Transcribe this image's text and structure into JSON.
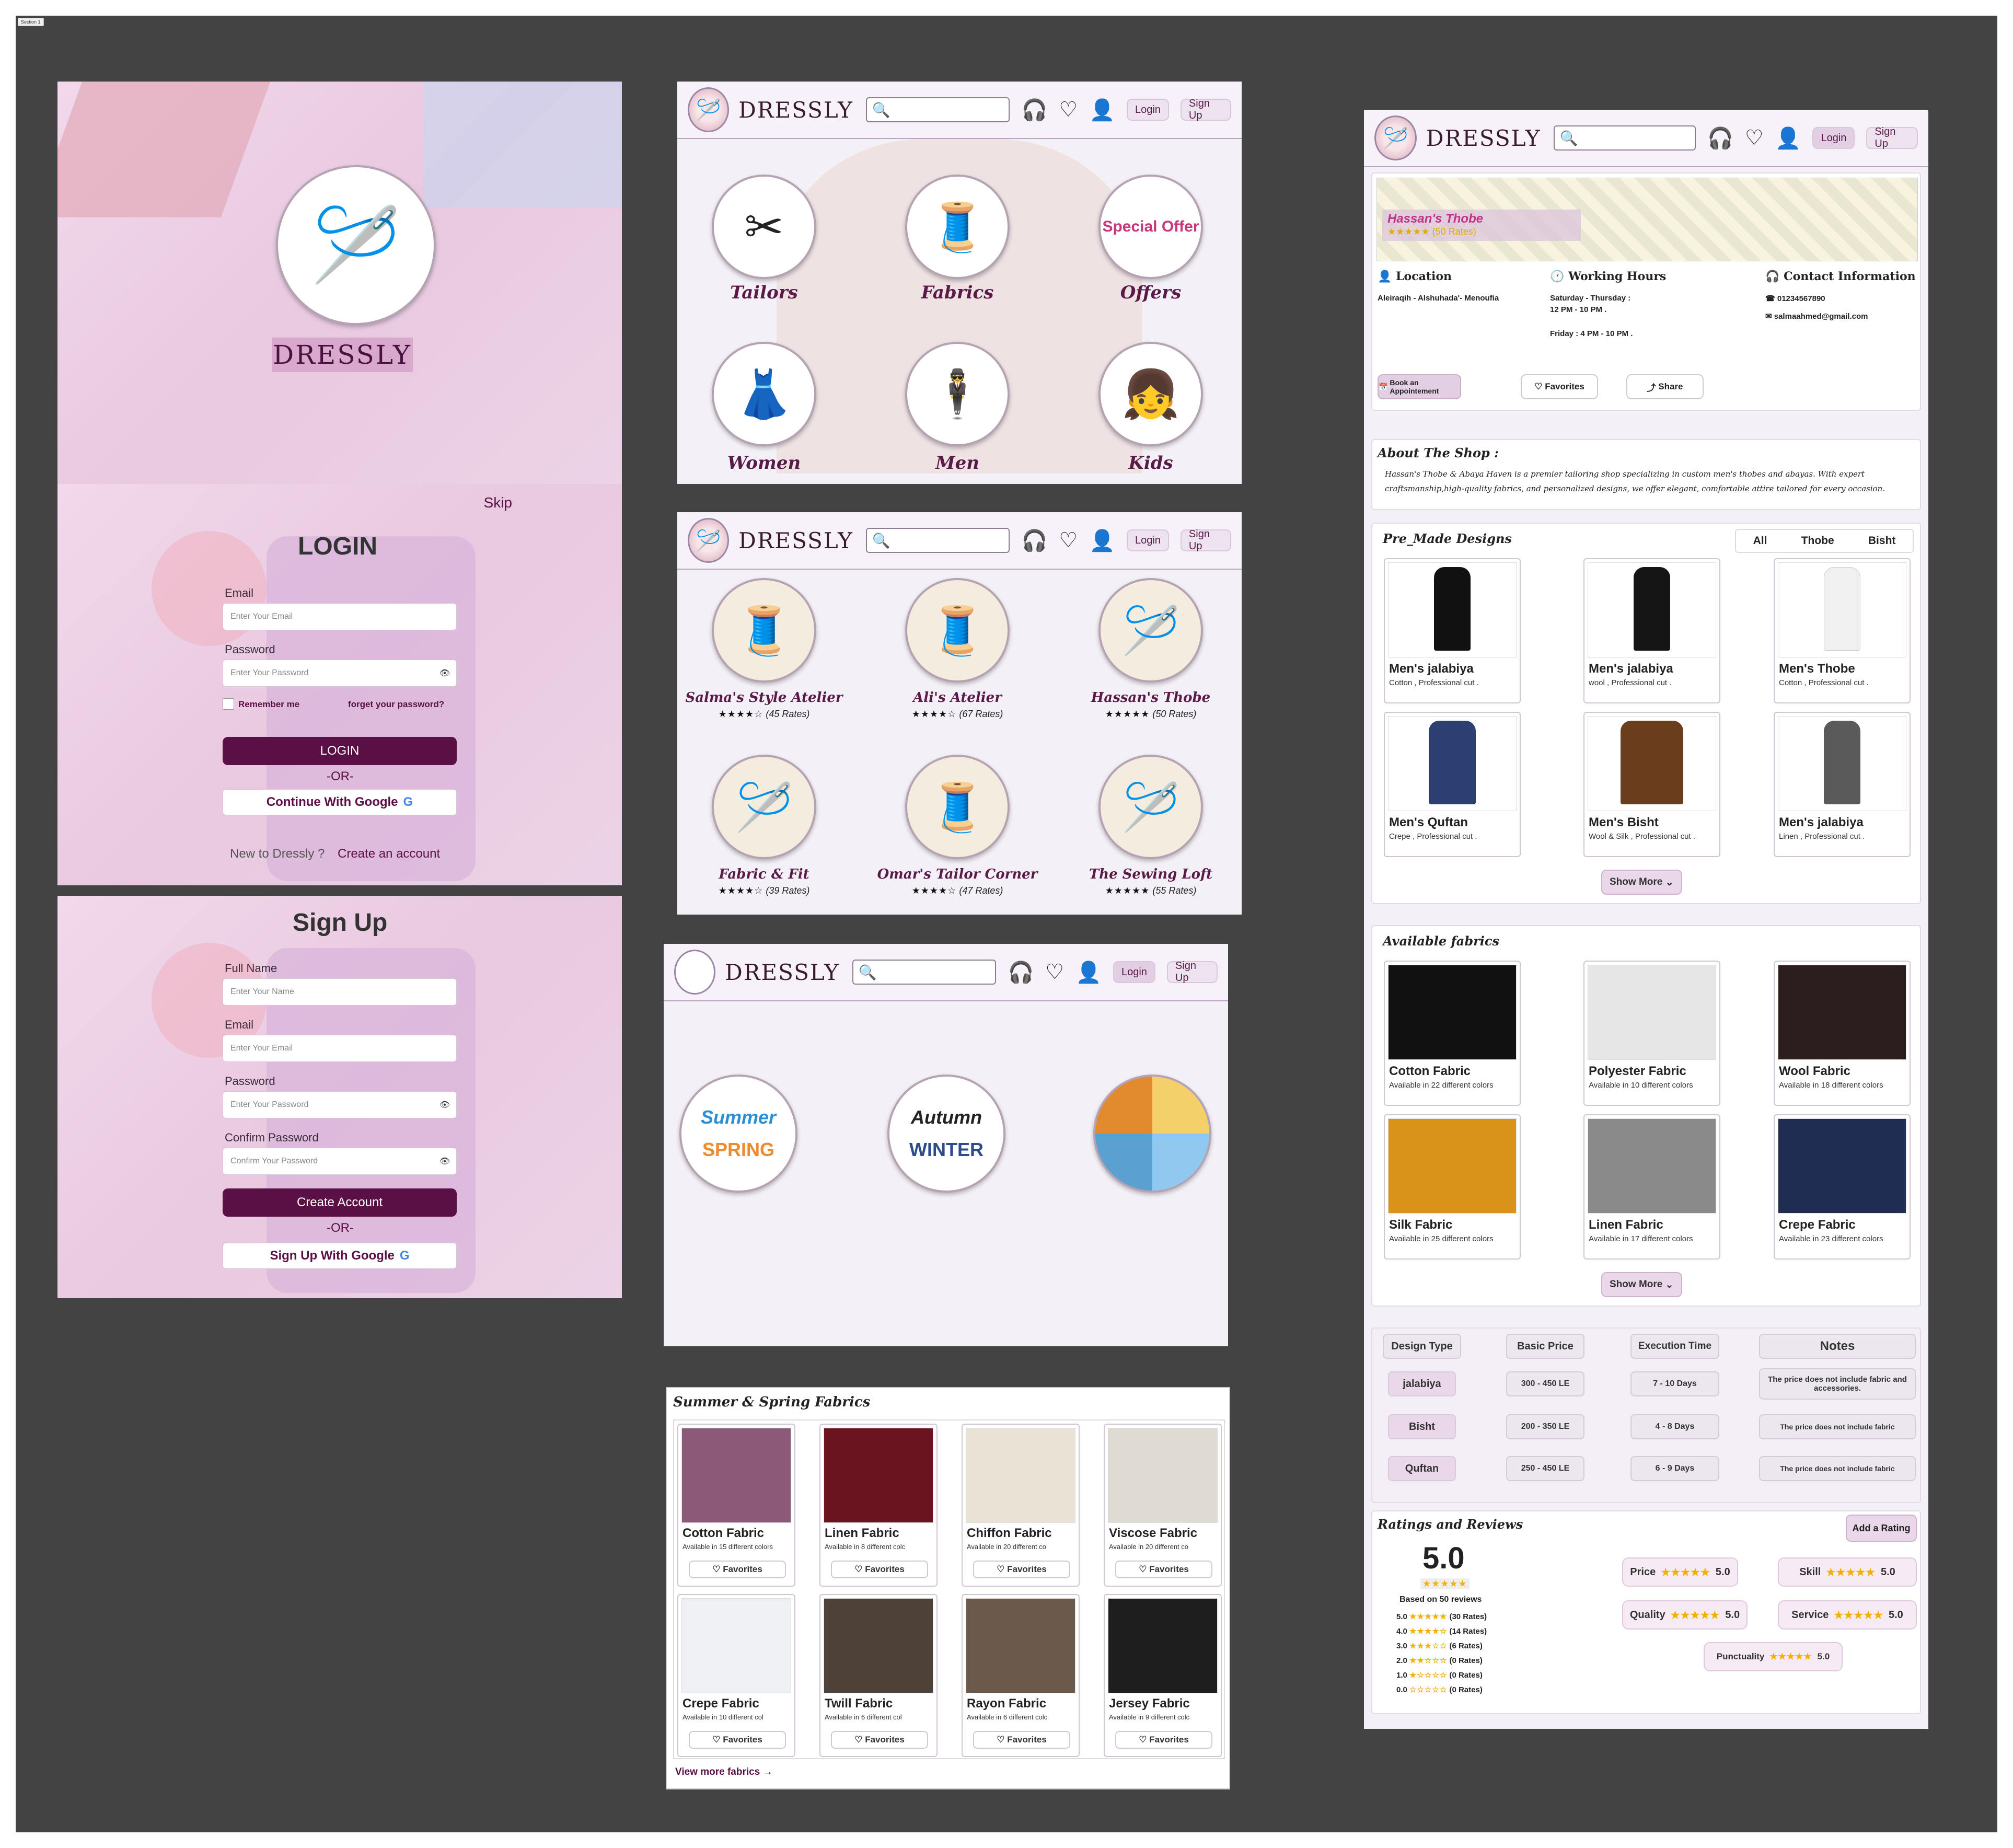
{
  "section_tag": "Section 1",
  "brand": "DRESSLY",
  "nav": {
    "login": "Login",
    "signup": "Sign Up"
  },
  "icons": {
    "search": "🔍",
    "support": "🎧",
    "heart": "♡",
    "user": "👤",
    "logo": "🪡"
  },
  "colors": {
    "primary": "#5a0f45",
    "accent": "#e3cfe3",
    "bg_dark": "#434343"
  },
  "splash": {
    "brand": "DRESSLY"
  },
  "login": {
    "skip": "Skip",
    "title": "LOGIN",
    "email_label": "Email",
    "email_ph": "Enter Your Email",
    "password_label": "Password",
    "password_ph": "Enter Your Password",
    "remember": "Remember me",
    "forgot": "forget your password?",
    "button": "LOGIN",
    "or": "-OR-",
    "google": "Continue With Google",
    "new_text": "New to Dressly ?",
    "create": "Create an account"
  },
  "signup": {
    "title": "Sign Up",
    "name_label": "Full Name",
    "name_ph": "Enter Your Name",
    "email_label": "Email",
    "email_ph": "Enter Your Email",
    "password_label": "Password",
    "password_ph": "Enter Your Password",
    "confirm_label": "Confirm Password",
    "confirm_ph": "Confirm Your Password",
    "button": "Create Account",
    "or": "-OR-",
    "google": "Sign Up With Google"
  },
  "home": {
    "categories": [
      {
        "label": "Tailors",
        "icon": "✂"
      },
      {
        "label": "Fabrics",
        "icon": "🧵"
      },
      {
        "label": "Offers",
        "icon": "Special Offer"
      },
      {
        "label": "Women",
        "icon": "👗"
      },
      {
        "label": "Men",
        "icon": "🕴"
      },
      {
        "label": "Kids",
        "icon": "👧"
      }
    ]
  },
  "tailors": [
    {
      "name": "Salma's Style Atelier",
      "stars": "★★★★☆",
      "rates": "(45 Rates)"
    },
    {
      "name": "Ali's Atelier",
      "stars": "★★★★☆",
      "rates": "(67 Rates)"
    },
    {
      "name": "Hassan's Thobe",
      "stars": "★★★★★",
      "rates": "(50 Rates)"
    },
    {
      "name": "Fabric & Fit",
      "stars": "★★★★☆",
      "rates": "(39 Rates)"
    },
    {
      "name": "Omar's Tailor Corner",
      "stars": "★★★★☆",
      "rates": "(47 Rates)"
    },
    {
      "name": "The Sewing Loft",
      "stars": "★★★★★",
      "rates": "(55 Rates)"
    }
  ],
  "seasons": [
    {
      "label": "Summer",
      "label2": "SPRING"
    },
    {
      "label": "Autumn",
      "label2": "WINTER"
    },
    {
      "label": "",
      "label2": ""
    }
  ],
  "fabrics_list": {
    "title": "Summer & Spring Fabrics",
    "items": [
      {
        "name": "Cotton Fabric",
        "sub": "Available in 15 different colors",
        "color": "#8a5a78"
      },
      {
        "name": "Linen Fabric",
        "sub": "Available in 8 different colc",
        "color": "#6a1420"
      },
      {
        "name": "Chiffon Fabric",
        "sub": "Available in 20 different co",
        "color": "#e9e3d6"
      },
      {
        "name": "Viscose Fabric",
        "sub": "Available in 20 different co",
        "color": "#dfdad2"
      },
      {
        "name": "Crepe Fabric",
        "sub": "Available in 10 different col",
        "color": "#eef0f4"
      },
      {
        "name": "Twill Fabric",
        "sub": "Available in 6 different col",
        "color": "#4e4238"
      },
      {
        "name": "Rayon Fabric",
        "sub": "Available in 6 different colc",
        "color": "#6b5a4c"
      },
      {
        "name": "Jersey Fabric",
        "sub": "Available in 9 different colc",
        "color": "#1e1e1e"
      }
    ],
    "fav": "Favorites",
    "view_more": "View more fabrics"
  },
  "shop": {
    "banner_name": "Hassan's Thobe",
    "banner_rates": "★★★★★ (50 Rates)",
    "location_title": "Location",
    "location": "Aleiraqih - Alshuhada'- Menoufia",
    "hours_title": "Working Hours",
    "hours1": "Saturday - Thursday :",
    "hours2": "12 PM - 10 PM .",
    "hours3": "Friday : 4 PM - 10 PM .",
    "contact_title": "Contact Information",
    "phone": "01234567890",
    "email": "salmaahmed@gmail.com",
    "book": "Book an Appointement",
    "favorites": "Favorites",
    "share": "Share",
    "about_title": "About The Shop :",
    "about_line1": "Hassan's Thobe & Abaya Haven is a premier tailoring shop specializing in custom men's thobes and abayas. With expert",
    "about_line2": "craftsmanship,high-quality fabrics, and personalized designs, we offer elegant, comfortable attire tailored for every occasion.",
    "premade_title": "Pre_Made Designs",
    "filters": [
      "All",
      "Thobe",
      "Bisht"
    ],
    "designs": [
      {
        "name": "Men's jalabiya",
        "sub": "Cotton , Professional cut  .",
        "color": "#111"
      },
      {
        "name": "Men's jalabiya",
        "sub": "wool , Professional cut  .",
        "color": "#151515"
      },
      {
        "name": "Men's Thobe",
        "sub": "Cotton , Professional cut  .",
        "color": "#f0f0f0"
      },
      {
        "name": "Men's Quftan",
        "sub": "Crepe , Professional cut  .",
        "color": "#2b3f73"
      },
      {
        "name": "Men's Bisht",
        "sub": "Wool & Silk , Professional cut  .",
        "color": "#6a3d1c"
      },
      {
        "name": "Men's jalabiya",
        "sub": "Linen , Professional cut  .",
        "color": "#5a5a5a"
      }
    ],
    "show_more": "Show More",
    "fabrics_title": "Available fabrics",
    "fabrics": [
      {
        "name": "Cotton Fabric",
        "sub": "Available in 22 different colors",
        "color": "#111"
      },
      {
        "name": "Polyester Fabric",
        "sub": "Available in 10 different colors",
        "color": "#e6e6e6"
      },
      {
        "name": "Wool Fabric",
        "sub": "Available in 18 different colors",
        "color": "#2c1e1e"
      },
      {
        "name": "Silk Fabric",
        "sub": "Available in 25 different colors",
        "color": "#d9931a"
      },
      {
        "name": "Linen Fabric",
        "sub": "Available in 17 different colors",
        "color": "#8a8a8a"
      },
      {
        "name": "Crepe Fabric",
        "sub": "Available in 23 different colors",
        "color": "#1f2d52"
      }
    ],
    "price_headers": [
      "Design Type",
      "Basic Price",
      "Execution Time",
      "Notes"
    ],
    "price_rows": [
      {
        "type": "jalabiya",
        "price": "300 - 450 LE",
        "time": "7 - 10 Days",
        "note": "The price does not include fabric and accessories."
      },
      {
        "type": "Bisht",
        "price": "200 - 350 LE",
        "time": "4 - 8 Days",
        "note": "The price does not include fabric"
      },
      {
        "type": "Quftan",
        "price": "250 - 450 LE",
        "time": "6 - 9 Days",
        "note": "The price does not include fabric"
      }
    ],
    "ratings_title": "Ratings and Reviews",
    "add_rating": "Add a Rating",
    "score": "5.0",
    "score_stars": "★★★★★",
    "based": "Based on 50 reviews",
    "dist": [
      {
        "lvl": "5.0",
        "stars": "★★★★★",
        "count": "(30 Rates)"
      },
      {
        "lvl": "4.0",
        "stars": "★★★★☆",
        "count": "(14 Rates)"
      },
      {
        "lvl": "3.0",
        "stars": "★★★☆☆",
        "count": "(6 Rates)"
      },
      {
        "lvl": "2.0",
        "stars": "★★☆☆☆",
        "count": "(0 Rates)"
      },
      {
        "lvl": "1.0",
        "stars": "★☆☆☆☆",
        "count": "(0 Rates)"
      },
      {
        "lvl": "0.0",
        "stars": "☆☆☆☆☆",
        "count": "(0 Rates)"
      }
    ],
    "criteria": [
      {
        "name": "Price",
        "stars": "★★★★★",
        "score": "5.0"
      },
      {
        "name": "Skill",
        "stars": "★★★★★",
        "score": "5.0"
      },
      {
        "name": "Quality",
        "stars": "★★★★★",
        "score": "5.0"
      },
      {
        "name": "Service",
        "stars": "★★★★★",
        "score": "5.0"
      },
      {
        "name": "Punctuality",
        "stars": "★★★★★",
        "score": "5.0"
      }
    ]
  }
}
